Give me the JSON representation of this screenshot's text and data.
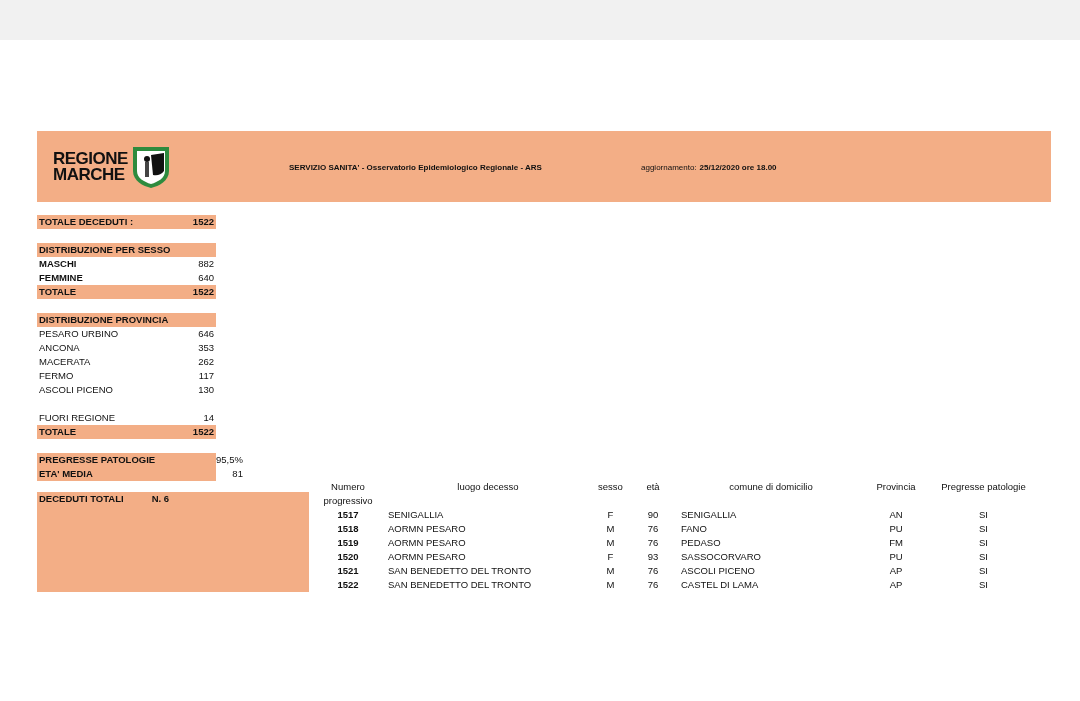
{
  "header": {
    "logo_lines": [
      "REGIONE",
      "MARCHE"
    ],
    "title": "SERVIZIO SANITA' - Osservatorio Epidemiologico Regionale - ARS",
    "update_label": "aggiornamento:",
    "update_value": "25/12/2020 ore 18.00"
  },
  "total_deaths": {
    "label": "TOTALE DECEDUTI :",
    "value": "1522"
  },
  "sections": [
    {
      "kind": "bold",
      "title": "DISTRIBUZIONE PER SESSO",
      "rows": [
        {
          "label": "MASCHI",
          "value": "882"
        },
        {
          "label": "FEMMINE",
          "value": "640"
        }
      ],
      "total": {
        "label": "TOTALE",
        "value": "1522"
      }
    },
    {
      "kind": "plain",
      "title": "DISTRIBUZIONE  PROVINCIA",
      "rows": [
        {
          "label": "PESARO URBINO",
          "value": "646"
        },
        {
          "label": "ANCONA",
          "value": "353"
        },
        {
          "label": "MACERATA",
          "value": "262"
        },
        {
          "label": "FERMO",
          "value": "117"
        },
        {
          "label": "ASCOLI PICENO",
          "value": "130"
        }
      ],
      "extra_rows": [
        {
          "label": "FUORI REGIONE",
          "value": "14"
        }
      ],
      "total": {
        "label": "TOTALE",
        "value": "1522"
      }
    }
  ],
  "indicators": [
    {
      "label": "PREGRESSE PATOLOGIE",
      "value": "95,5%"
    },
    {
      "label": "ETA' MEDIA",
      "value": "81"
    }
  ],
  "deaths_box": {
    "label": "DECEDUTI TOTALI",
    "count": "N. 6"
  },
  "table": {
    "columns": [
      "Numero progressivo",
      "luogo decesso",
      "sesso",
      "età",
      "comune di domicilio",
      "Provincia",
      "Pregresse patologie"
    ],
    "rows": [
      [
        "1517",
        "SENIGALLIA",
        "F",
        "90",
        "SENIGALLIA",
        "AN",
        "SI"
      ],
      [
        "1518",
        "AORMN PESARO",
        "M",
        "76",
        "FANO",
        "PU",
        "SI"
      ],
      [
        "1519",
        "AORMN PESARO",
        "M",
        "76",
        "PEDASO",
        "FM",
        "SI"
      ],
      [
        "1520",
        "AORMN PESARO",
        "F",
        "93",
        "SASSOCORVARO",
        "PU",
        "SI"
      ],
      [
        "1521",
        "SAN BENEDETTO DEL TRONTO",
        "M",
        "76",
        "ASCOLI PICENO",
        "AP",
        "SI"
      ],
      [
        "1522",
        "SAN BENEDETTO DEL TRONTO",
        "M",
        "76",
        "CASTEL DI LAMA",
        "AP",
        "SI"
      ]
    ]
  }
}
